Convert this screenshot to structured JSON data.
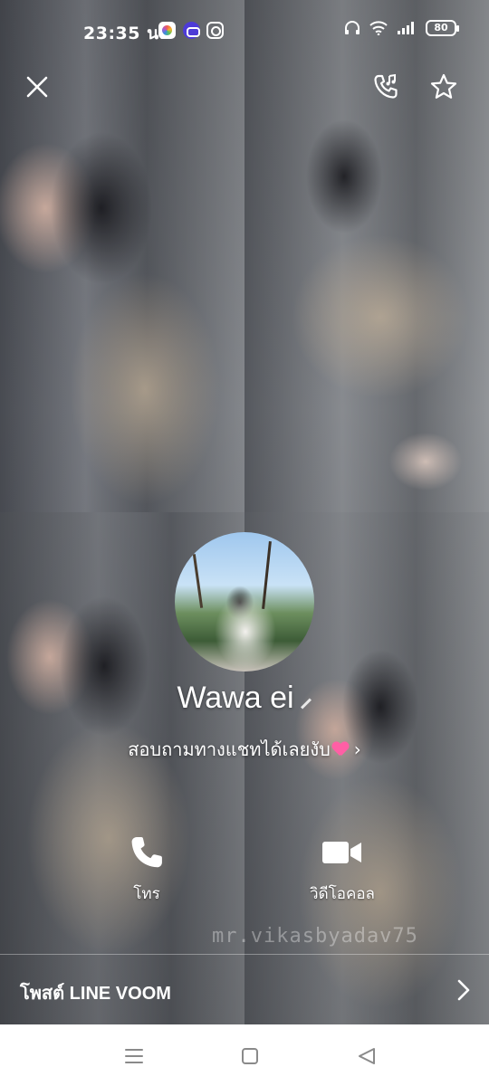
{
  "status_bar": {
    "time": "23:35 น.",
    "battery": "80",
    "icons": [
      "photos-app-icon",
      "game-app-icon",
      "instagram-icon",
      "headphones-icon",
      "wifi-icon",
      "signal-icon",
      "battery-icon"
    ]
  },
  "top_bar": {
    "close_icon": "close-icon",
    "ringtone_icon": "phone-music-icon",
    "favorite_icon": "star-outline-icon"
  },
  "profile": {
    "name": "Wawa ei",
    "status_message": "สอบถามทางแชทได้เลยงับ",
    "status_chevron": "›"
  },
  "actions": {
    "call_label": "โทร",
    "video_label": "วิดีโอคอล"
  },
  "watermark": "mr.vikasbyadav75",
  "voom": {
    "label": "โพสต์ LINE VOOM"
  },
  "colors": {
    "text": "#ffffff",
    "heart": "#ff5fa5",
    "nav_bg": "#ffffff",
    "nav_icon": "#8a8a8a"
  }
}
